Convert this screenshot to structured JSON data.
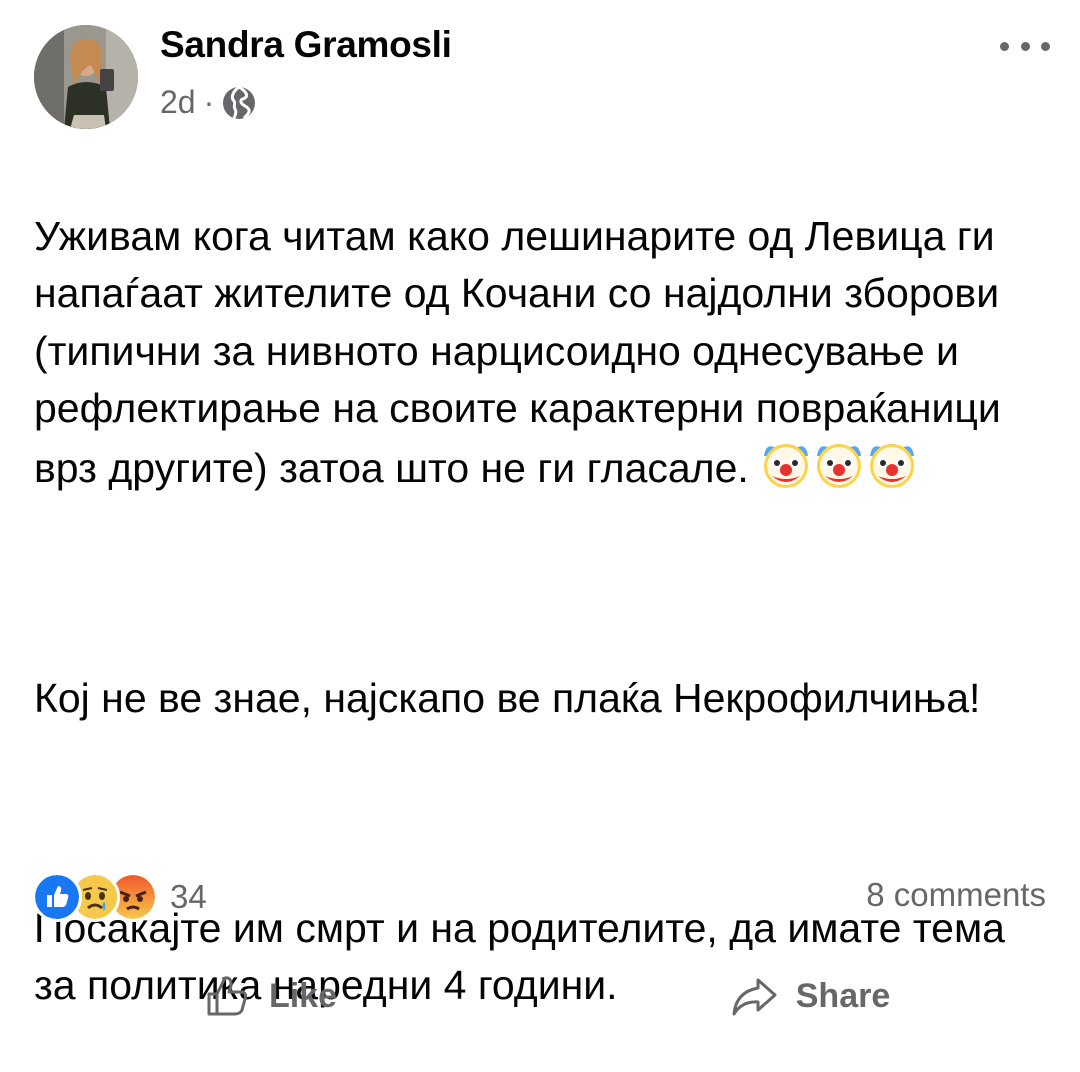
{
  "post": {
    "author": "Sandra Gramosli",
    "time": "2d",
    "separator": "·",
    "audience_icon": "globe-icon",
    "more_icon": "more-options-icon",
    "paragraph1": "Уживам кога читам како лешинарите од Левица ги напаѓаат жителите од Кочани со најдолни зборови (типични за нивното нарцисоидно однесување и рефлектирање на своите карактерни повраќаници врз другите) затоа што не ги гласале.",
    "paragraph1_emojis": [
      "clown-face",
      "clown-face",
      "clown-face"
    ],
    "paragraph2": "Кој не ве знае, најскапо ве плаќа Некрофилчиња!",
    "paragraph3": "Посакајте им смрт и на родителите, да имате тема за политика наредни 4 години."
  },
  "reactions": {
    "icons": [
      "like-reaction-icon",
      "sad-reaction-icon",
      "angry-reaction-icon"
    ],
    "count": "34",
    "comments": "8 comments"
  },
  "actions": {
    "like": "Like",
    "share": "Share"
  },
  "colors": {
    "text": "#050505",
    "secondary": "#65676b",
    "like_blue": "#1877f2",
    "angry": "#f0592b",
    "sad": "#f7c94b"
  }
}
